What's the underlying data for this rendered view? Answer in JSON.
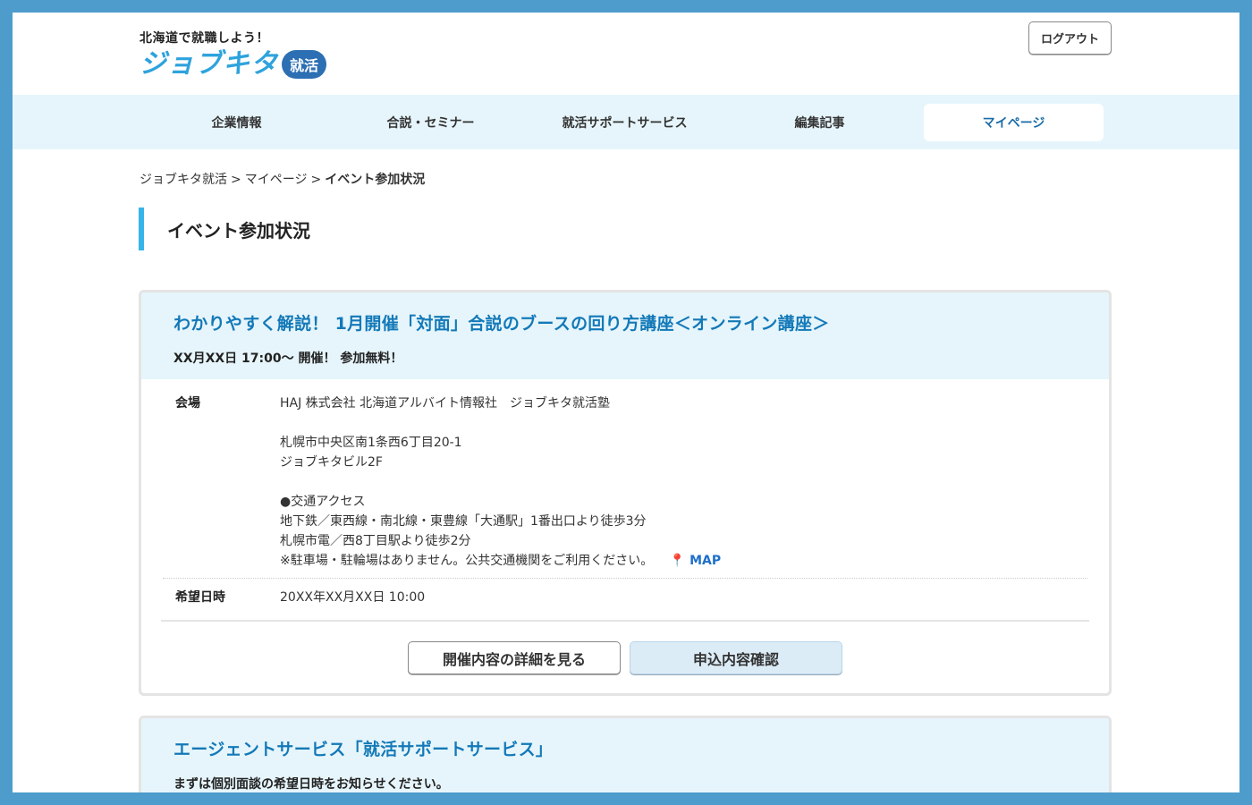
{
  "header": {
    "tagline": "北海道で就職しよう！",
    "brand": "ジョブキタ",
    "brand_badge": "就活",
    "logout_label": "ログアウト"
  },
  "nav": {
    "items": [
      {
        "label": "企業情報"
      },
      {
        "label": "合説・セミナー"
      },
      {
        "label": "就活サポートサービス"
      },
      {
        "label": "編集記事"
      },
      {
        "label": "マイページ"
      }
    ],
    "active_index": 4
  },
  "breadcrumb": {
    "items": [
      "ジョブキタ就活",
      "マイページ"
    ],
    "separator": ">",
    "current": "イベント参加状況"
  },
  "page_title": "イベント参加状況",
  "event_card": {
    "title": "わかりやすく解説！ 1月開催「対面」合説のブースの回り方講座＜オンライン講座＞",
    "subtitle": "XX月XX日 17:00〜 開催！ 参加無料！",
    "venue_label": "会場",
    "venue_lines": [
      "HAJ 株式会社 北海道アルバイト情報社　ジョブキタ就活塾",
      "",
      "札幌市中央区南1条西6丁目20-1",
      "ジョブキタビル2F",
      "",
      "●交通アクセス",
      "地下鉄／東西線・南北線・東豊線「大通駅」1番出口より徒歩3分",
      "札幌市電／西8丁目駅より徒歩2分"
    ],
    "venue_note": "※駐車場・駐輪場はありません。公共交通機関をご利用ください。",
    "map_label": "MAP",
    "date_label": "希望日時",
    "date_value": "20XX年XX月XX日 10:00",
    "detail_button": "開催内容の詳細を見る",
    "confirm_button": "申込内容確認"
  },
  "agent_card": {
    "title": "エージェントサービス「就活サポートサービス」",
    "subtitle": "まずは個別面談の希望日時をお知らせください。"
  },
  "colors": {
    "frame": "#4d9ccb",
    "nav_bg": "#e6f5fb",
    "accent": "#36b5e8",
    "title_blue": "#1379b8",
    "map_pin": "#e5403b"
  }
}
